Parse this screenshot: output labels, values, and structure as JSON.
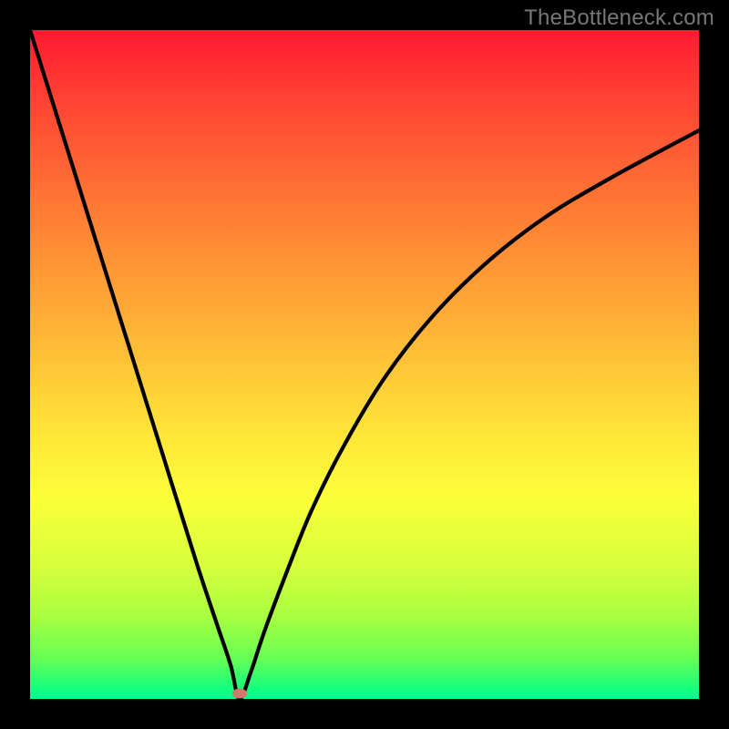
{
  "watermark": "TheBottleneck.com",
  "marker": {
    "x_frac": 0.313,
    "y_frac": 0.992
  },
  "colors": {
    "gradient_top": "#ff1a32",
    "gradient_bottom": "#00ff90",
    "curve": "#000000",
    "marker": "#cf7a6a",
    "frame": "#000000",
    "watermark_text": "#777777"
  },
  "chart_data": {
    "type": "line",
    "title": "",
    "xlabel": "",
    "ylabel": "",
    "xlim": [
      0,
      1
    ],
    "ylim": [
      0,
      1
    ],
    "series": [
      {
        "name": "bottleneck-curve",
        "x": [
          0.0,
          0.05,
          0.1,
          0.15,
          0.2,
          0.25,
          0.28,
          0.3,
          0.313,
          0.33,
          0.35,
          0.38,
          0.42,
          0.47,
          0.53,
          0.6,
          0.68,
          0.77,
          0.87,
          1.0
        ],
        "values": [
          1.0,
          0.84,
          0.68,
          0.52,
          0.36,
          0.2,
          0.11,
          0.05,
          0.0,
          0.04,
          0.1,
          0.18,
          0.28,
          0.38,
          0.48,
          0.57,
          0.65,
          0.72,
          0.78,
          0.85
        ]
      }
    ],
    "annotations": [
      {
        "name": "minimum-marker",
        "x": 0.313,
        "y": 0.008
      }
    ],
    "background": "vertical-gradient red→orange→yellow→green"
  }
}
